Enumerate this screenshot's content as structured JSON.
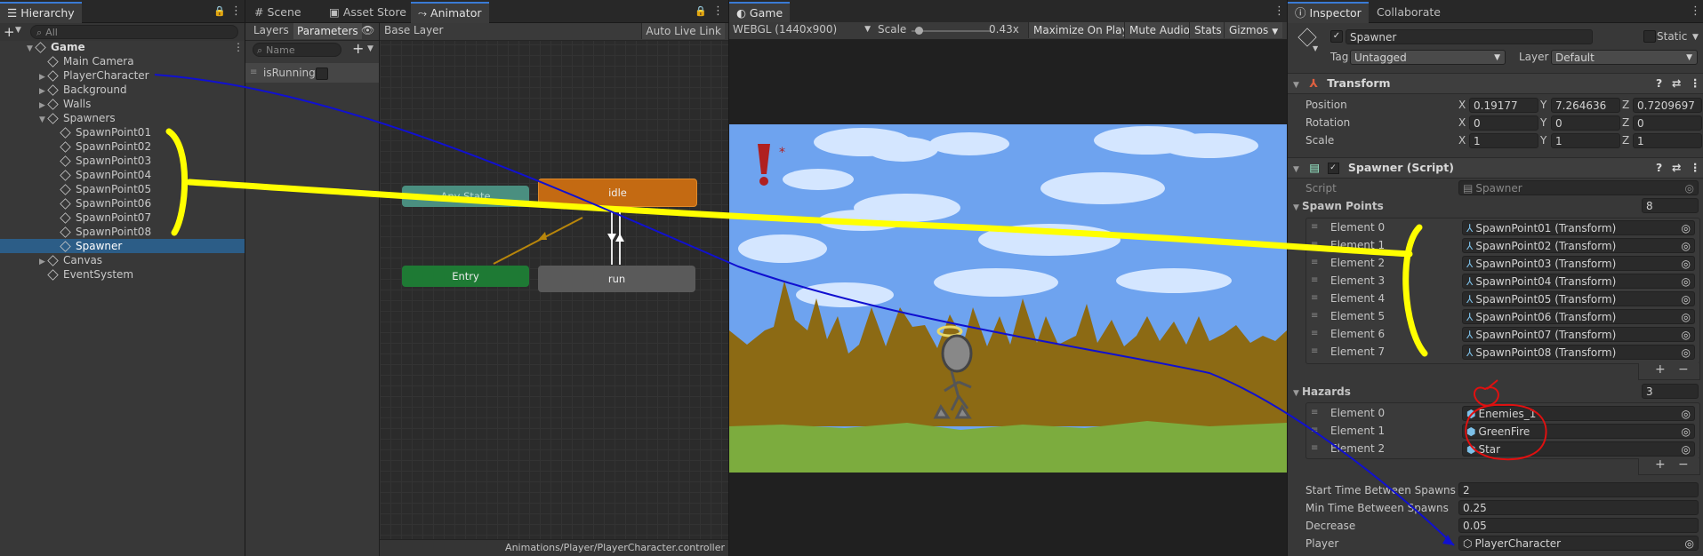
{
  "hierarchy": {
    "tab": "Hierarchy",
    "add_label": "+",
    "search_placeholder": "All",
    "root": "Game",
    "items": [
      {
        "label": "Main Camera",
        "arrow": ""
      },
      {
        "label": "PlayerCharacter",
        "arrow": "▶"
      },
      {
        "label": "Background",
        "arrow": "▶"
      },
      {
        "label": "Walls",
        "arrow": "▶"
      },
      {
        "label": "Spawners",
        "arrow": "▼"
      },
      {
        "label": "SpawnPoint01",
        "arrow": ""
      },
      {
        "label": "SpawnPoint02",
        "arrow": ""
      },
      {
        "label": "SpawnPoint03",
        "arrow": ""
      },
      {
        "label": "SpawnPoint04",
        "arrow": ""
      },
      {
        "label": "SpawnPoint05",
        "arrow": ""
      },
      {
        "label": "SpawnPoint06",
        "arrow": ""
      },
      {
        "label": "SpawnPoint07",
        "arrow": ""
      },
      {
        "label": "SpawnPoint08",
        "arrow": ""
      },
      {
        "label": "Spawner",
        "arrow": ""
      },
      {
        "label": "Canvas",
        "arrow": "▶"
      },
      {
        "label": "EventSystem",
        "arrow": ""
      }
    ]
  },
  "center_tabs": {
    "scene": "Scene",
    "asset_store": "Asset Store",
    "animator": "Animator"
  },
  "animator": {
    "layers_tab": "Layers",
    "parameters_tab": "Parameters",
    "base_layer": "Base Layer",
    "auto_live_link": "Auto Live Link",
    "search_placeholder": "Name",
    "add_label": "+",
    "param_name": "isRunning",
    "nodes": {
      "any_state": "Any State",
      "idle": "idle",
      "entry": "Entry",
      "run": "run"
    },
    "footer_path": "Animations/Player/PlayerCharacter.controller"
  },
  "game": {
    "tab": "Game",
    "resolution": "WEBGL (1440x900)",
    "scale_label": "Scale",
    "scale_value": "0.43x",
    "scale_fraction": 0.05,
    "maximize": "Maximize On Play",
    "mute": "Mute Audio",
    "stats": "Stats",
    "gizmos": "Gizmos"
  },
  "inspector": {
    "tab": "Inspector",
    "collaborate_tab": "Collaborate",
    "object_name": "Spawner",
    "static_label": "Static",
    "tag_label": "Tag",
    "tag_value": "Untagged",
    "layer_label": "Layer",
    "layer_value": "Default",
    "transform": {
      "title": "Transform",
      "position_label": "Position",
      "rotation_label": "Rotation",
      "scale_label": "Scale",
      "position": [
        "0.19177",
        "7.264636",
        "0.7209697"
      ],
      "rotation": [
        "0",
        "0",
        "0"
      ],
      "scale": [
        "1",
        "1",
        "1"
      ]
    },
    "spawner": {
      "title": "Spawner (Script)",
      "script_label": "Script",
      "script_value": "Spawner",
      "spawn_points_label": "Spawn Points",
      "spawn_points_count": "8",
      "spawn_points": [
        {
          "label": "Element 0",
          "value": "SpawnPoint01 (Transform)"
        },
        {
          "label": "Element 1",
          "value": "SpawnPoint02 (Transform)"
        },
        {
          "label": "Element 2",
          "value": "SpawnPoint03 (Transform)"
        },
        {
          "label": "Element 3",
          "value": "SpawnPoint04 (Transform)"
        },
        {
          "label": "Element 4",
          "value": "SpawnPoint05 (Transform)"
        },
        {
          "label": "Element 5",
          "value": "SpawnPoint06 (Transform)"
        },
        {
          "label": "Element 6",
          "value": "SpawnPoint07 (Transform)"
        },
        {
          "label": "Element 7",
          "value": "SpawnPoint08 (Transform)"
        }
      ],
      "hazards_label": "Hazards",
      "hazards_count": "3",
      "hazards": [
        {
          "label": "Element 0",
          "value": "Enemies_1"
        },
        {
          "label": "Element 1",
          "value": "GreenFire"
        },
        {
          "label": "Element 2",
          "value": "Star"
        }
      ],
      "start_time_label": "Start Time Between Spawns",
      "start_time_value": "2",
      "min_time_label": "Min Time Between Spawns",
      "min_time_value": "0.25",
      "decrease_label": "Decrease",
      "decrease_value": "0.05",
      "player_label": "Player",
      "player_value": "PlayerCharacter"
    }
  },
  "colors": {
    "annotation_yellow": "#ffff00",
    "annotation_blue": "#1010d0",
    "annotation_red": "#e01010",
    "sky": "#6ea3ef",
    "mountain": "#8c6a14",
    "grass": "#7cac3e",
    "node_orange": "#c46a12",
    "node_green": "#1e7a34",
    "node_teal": "#4a8f80",
    "node_gray": "#5a5a5a"
  }
}
